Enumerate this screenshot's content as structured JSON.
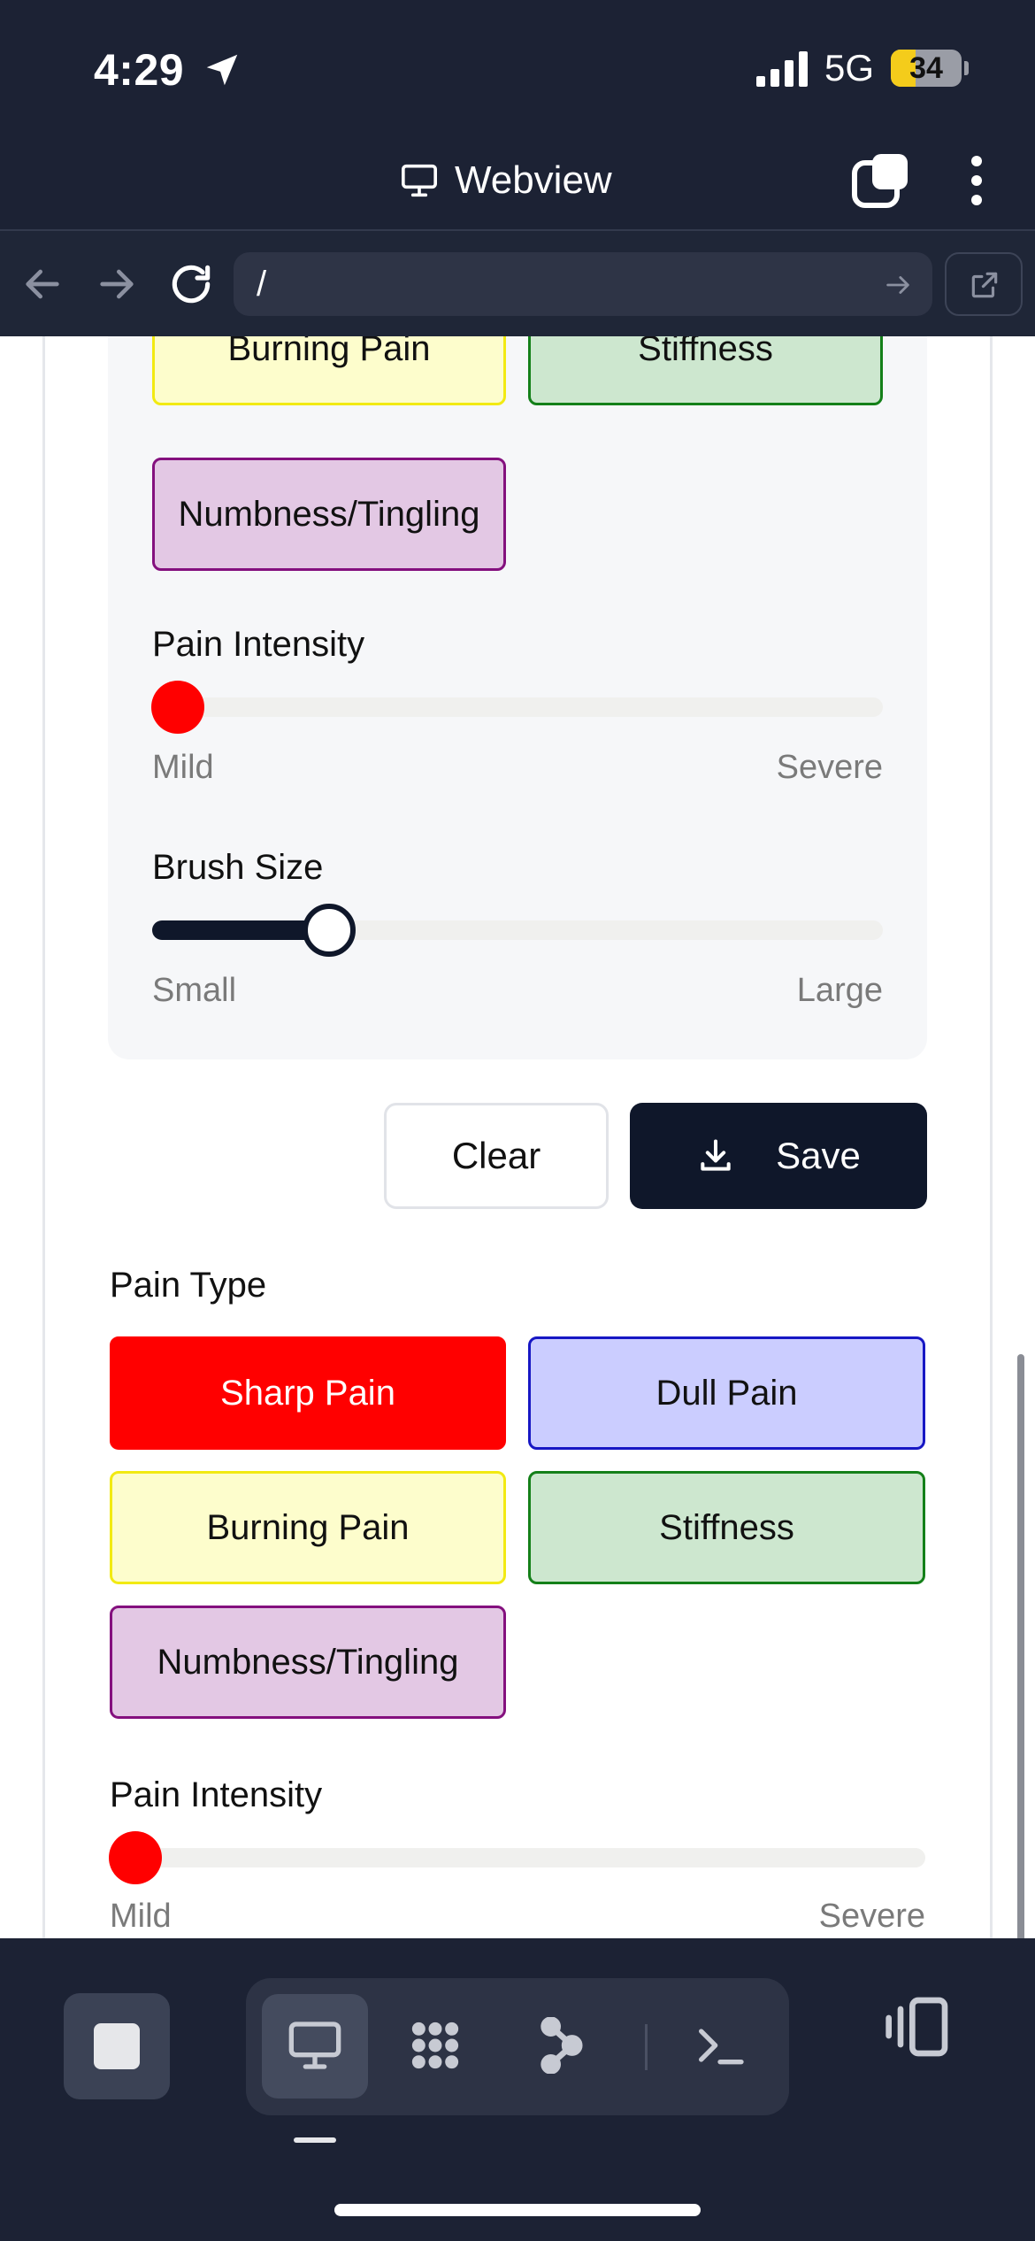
{
  "status_bar": {
    "time": "4:29",
    "network": "5G",
    "battery": "34",
    "battery_level_percent": 34
  },
  "title_bar": {
    "title": "Webview",
    "icon": "monitor-icon"
  },
  "address_bar": {
    "url": "/"
  },
  "content": {
    "top_panel": {
      "pain_type_chips": [
        {
          "label": "Burning Pain",
          "color": "#fdfdcc",
          "border": "#f2ea12"
        },
        {
          "label": "Stiffness",
          "color": "#cde7cf",
          "border": "#148019"
        },
        {
          "label": "Numbness/Tingling",
          "color": "#e3c8e4",
          "border": "#84107e"
        }
      ],
      "intensity": {
        "label": "Pain Intensity",
        "min_label": "Mild",
        "max_label": "Severe",
        "value_fraction": 0.0,
        "thumb_color": "#ff0000"
      },
      "brush": {
        "label": "Brush Size",
        "min_label": "Small",
        "max_label": "Large",
        "value_fraction": 0.24
      }
    },
    "actions": {
      "clear_label": "Clear",
      "save_label": "Save"
    },
    "second_panel": {
      "section_title": "Pain Type",
      "pain_type_chips": [
        {
          "label": "Sharp Pain",
          "color": "#ff0000",
          "selected": true
        },
        {
          "label": "Dull Pain",
          "color": "#cbcdff",
          "border": "#1717c4"
        },
        {
          "label": "Burning Pain",
          "color": "#fdfdcc",
          "border": "#f2ea12"
        },
        {
          "label": "Stiffness",
          "color": "#cde7cf",
          "border": "#148019"
        },
        {
          "label": "Numbness/Tingling",
          "color": "#e3c8e4",
          "border": "#84107e"
        }
      ],
      "intensity": {
        "label": "Pain Intensity",
        "min_label": "Mild",
        "max_label": "Severe",
        "value_fraction": 0.0,
        "thumb_color": "#ff0000"
      }
    }
  },
  "dock": {
    "stop_icon": "stop-icon",
    "tools": [
      "monitor-icon",
      "apps-grid-icon",
      "graph-nodes-icon",
      "terminal-icon"
    ],
    "active_tool": "monitor-icon",
    "side_icon": "sidebar-toggle-icon"
  },
  "colors": {
    "chrome_bg": "#1c2234",
    "accent_dark": "#0f172a",
    "danger": "#ff0000"
  }
}
